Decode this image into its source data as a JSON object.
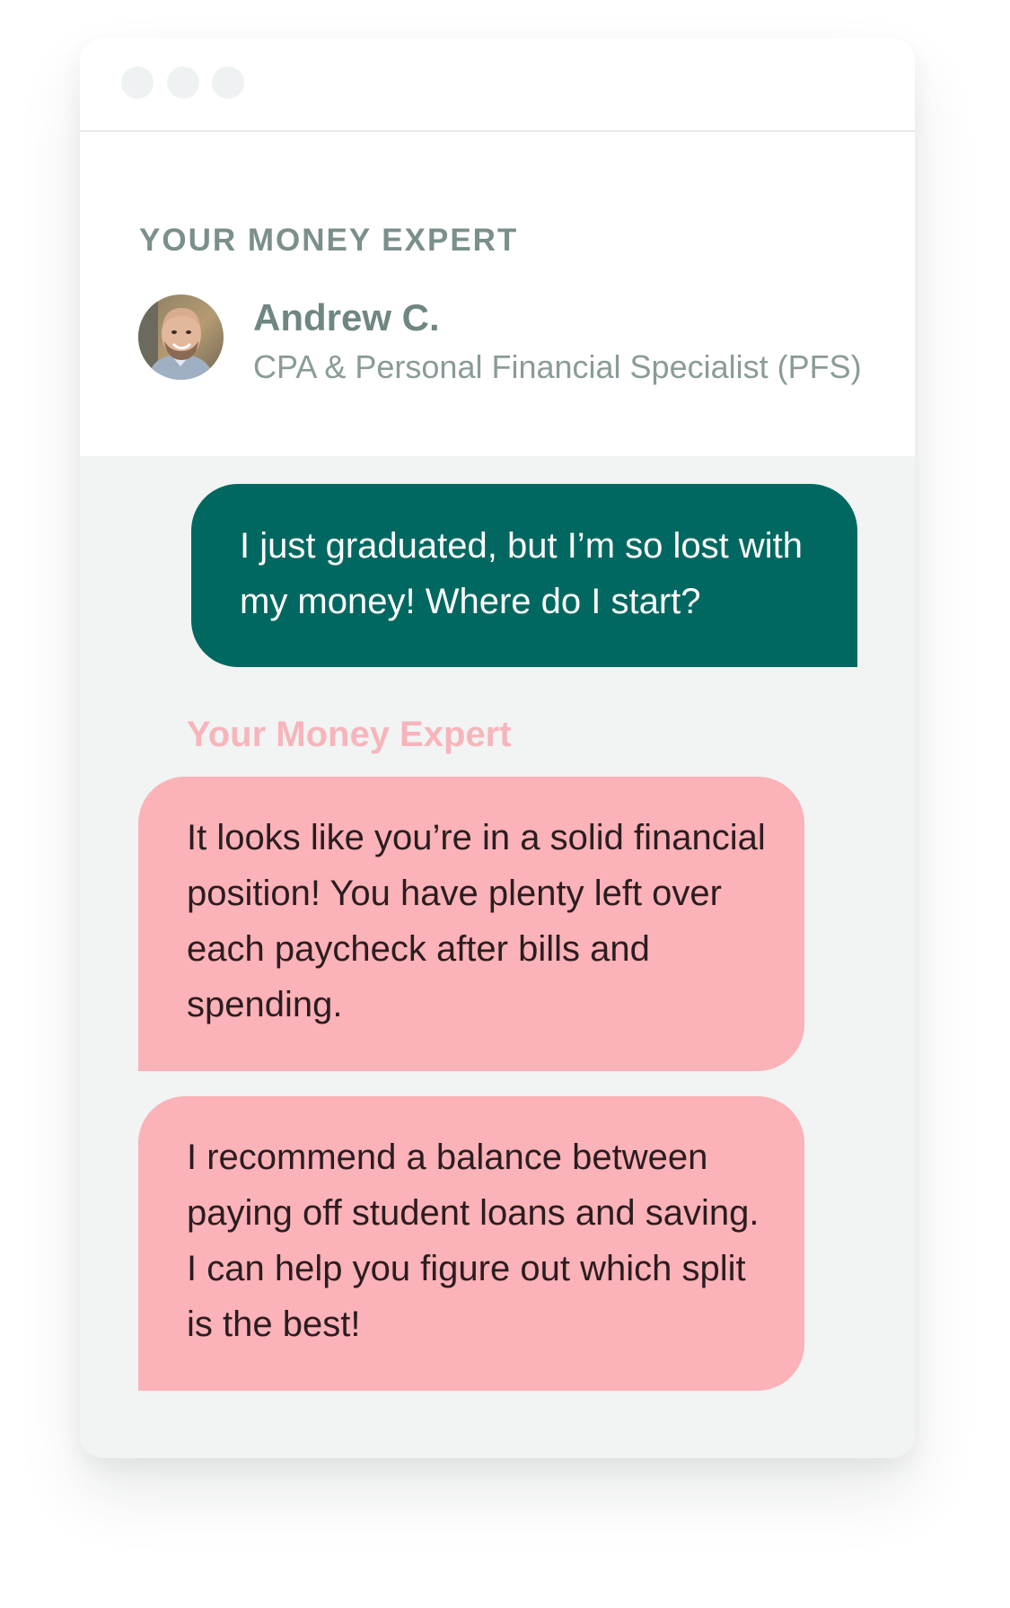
{
  "header": {
    "eyebrow": "YOUR MONEY EXPERT",
    "expert_name": "Andrew C.",
    "expert_title": "CPA & Personal Financial Specialist (PFS)"
  },
  "chat": {
    "user_message": "I just graduated, but I’m so lost with my money! Where do I start?",
    "sender_label": "Your Money Expert",
    "expert_messages": [
      "It looks like you’re in a solid financial position! You have plenty left over each paycheck after bills and spending.",
      "I recommend a balance between paying off student loans and saving. I can help you figure out which split is the best!"
    ]
  },
  "colors": {
    "user_bubble": "#006860",
    "expert_bubble": "#fbb2b8",
    "sender_label": "#f7b5bb",
    "heading_gray": "#7b8f8c"
  }
}
